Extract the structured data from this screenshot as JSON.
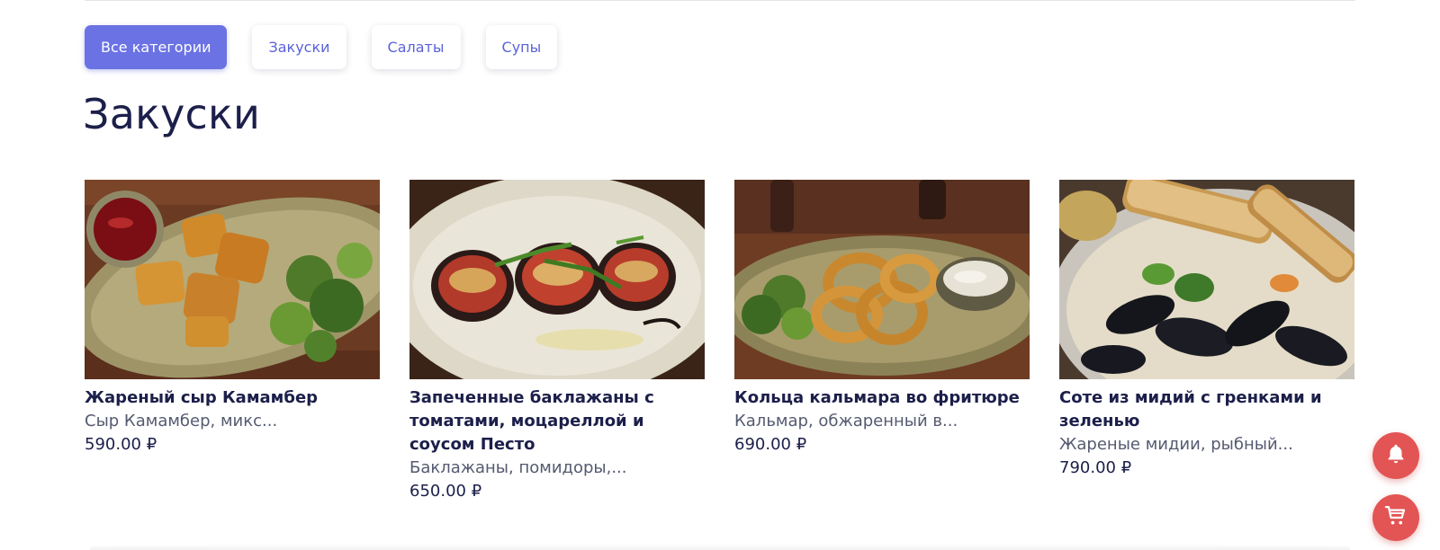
{
  "categories": {
    "items": [
      {
        "label": "Все категории",
        "active": true
      },
      {
        "label": "Закуски",
        "active": false
      },
      {
        "label": "Салаты",
        "active": false
      },
      {
        "label": "Супы",
        "active": false
      }
    ]
  },
  "section": {
    "title": "Закуски"
  },
  "products": [
    {
      "name": "Жареный сыр Камамбер",
      "description": "Сыр Камамбер, микс...",
      "price": "590.00 ₽",
      "image_icon": "fried-camembert-photo"
    },
    {
      "name": "Запеченные баклажаны с томатами, моцареллой и соусом Песто",
      "description": "Баклажаны, помидоры,...",
      "price": "650.00 ₽",
      "image_icon": "baked-eggplant-photo"
    },
    {
      "name": "Кольца кальмара во фритюре",
      "description": "Кальмар, обжаренный в...",
      "price": "690.00 ₽",
      "image_icon": "squid-rings-photo"
    },
    {
      "name": "Соте из мидий с гренками и зеленью",
      "description": "Жареные мидии, рыбный...",
      "price": "790.00 ₽",
      "image_icon": "mussels-saute-photo"
    }
  ],
  "floating_buttons": {
    "bell": "bell-icon",
    "cart": "cart-icon"
  },
  "colors": {
    "accent": "#6b72e3",
    "fab": "#e35454",
    "text": "#1c1f4a"
  }
}
